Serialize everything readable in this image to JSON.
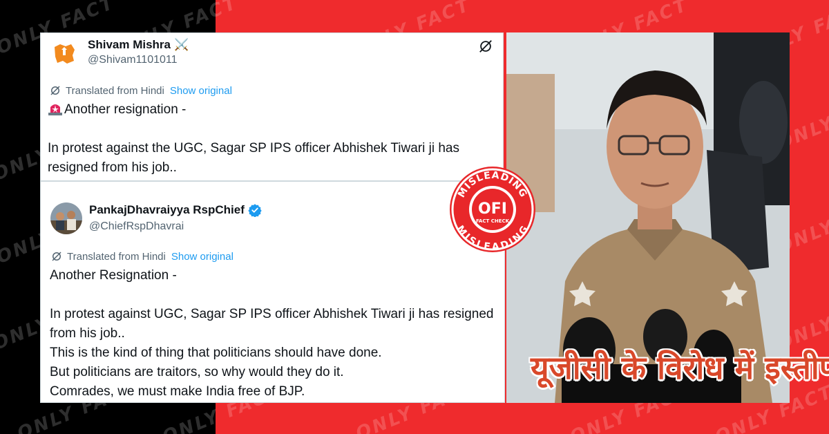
{
  "watermark": {
    "text": "ONLY FACT"
  },
  "tweet1": {
    "name": "Shivam Mishra",
    "name_emoji": "⚔️",
    "handle": "@Shivam1101011",
    "translated_label": "Translated from Hindi",
    "show_original": "Show original",
    "lead": "Another resignation -",
    "body": "In protest against the UGC, Sagar SP IPS officer Abhishek Tiwari ji has resigned from his job..\nThis is the kind of thing that politicians should have done."
  },
  "tweet2": {
    "name": "PankajDhavraiyya RspChief",
    "handle": "@ChiefRspDhavrai",
    "translated_label": "Translated from Hindi",
    "show_original": "Show original",
    "body": "Another Resignation -\n\nIn protest against UGC, Sagar SP IPS officer Abhishek Tiwari ji has resigned from his job..\nThis is the kind of thing that politicians should have done.\nBut politicians are traitors, so why would they do it.\nComrades, we must make India free of BJP."
  },
  "stamp": {
    "top_text": "MISLEADING",
    "logo": "OFI",
    "sub": "FACT CHECK",
    "bottom_text": "MISLEADING"
  },
  "photo": {
    "caption": "यूजीसी के विरोध में इस्तीफा"
  },
  "colors": {
    "brand_red": "#ef2b2d",
    "link_blue": "#1d9bf0",
    "verified_blue": "#1d9bf0",
    "caption_orange": "#d9482a"
  }
}
